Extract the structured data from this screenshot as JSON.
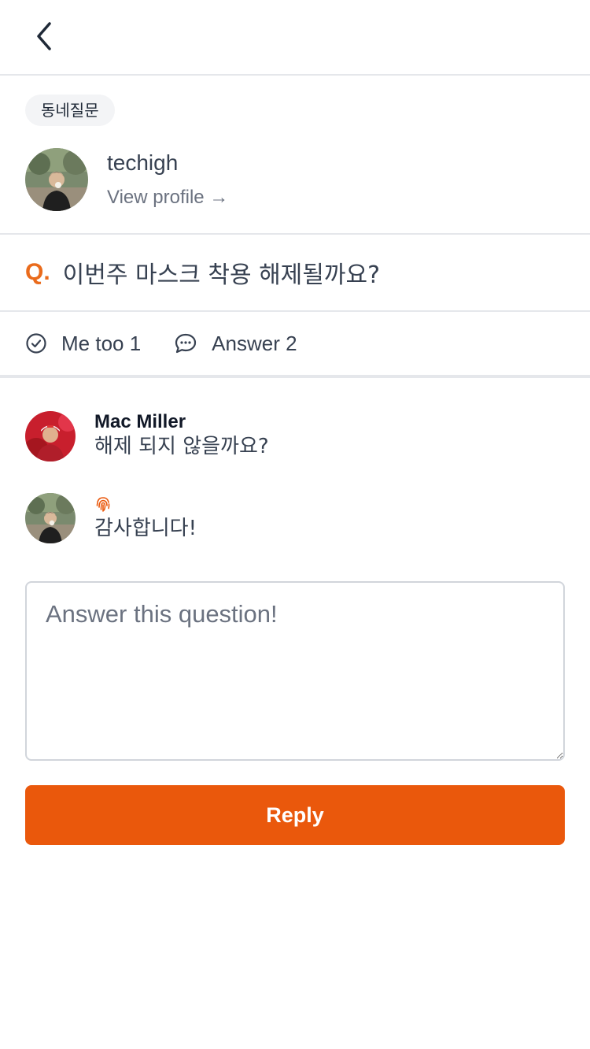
{
  "post": {
    "category": "동네질문",
    "author": {
      "name": "techigh",
      "view_profile": "View profile →"
    },
    "question_prefix": "Q.",
    "question": "이번주 마스크 착용 해제될까요?",
    "stats": {
      "me_too": "Me too 1",
      "answers": "Answer 2"
    }
  },
  "answers": [
    {
      "author": "Mac Miller",
      "text": "해제 되지 않을까요?",
      "avatar": "red-avatar"
    },
    {
      "author": "",
      "text": "감사합니다!",
      "avatar": "techigh-avatar",
      "badge_icon": "fingerprint-icon"
    }
  ],
  "reply_form": {
    "placeholder": "Answer this question!",
    "submit_label": "Reply"
  },
  "colors": {
    "accent": "#ea580c",
    "question_mark": "#ea6b1c",
    "divider": "#e5e7eb"
  }
}
